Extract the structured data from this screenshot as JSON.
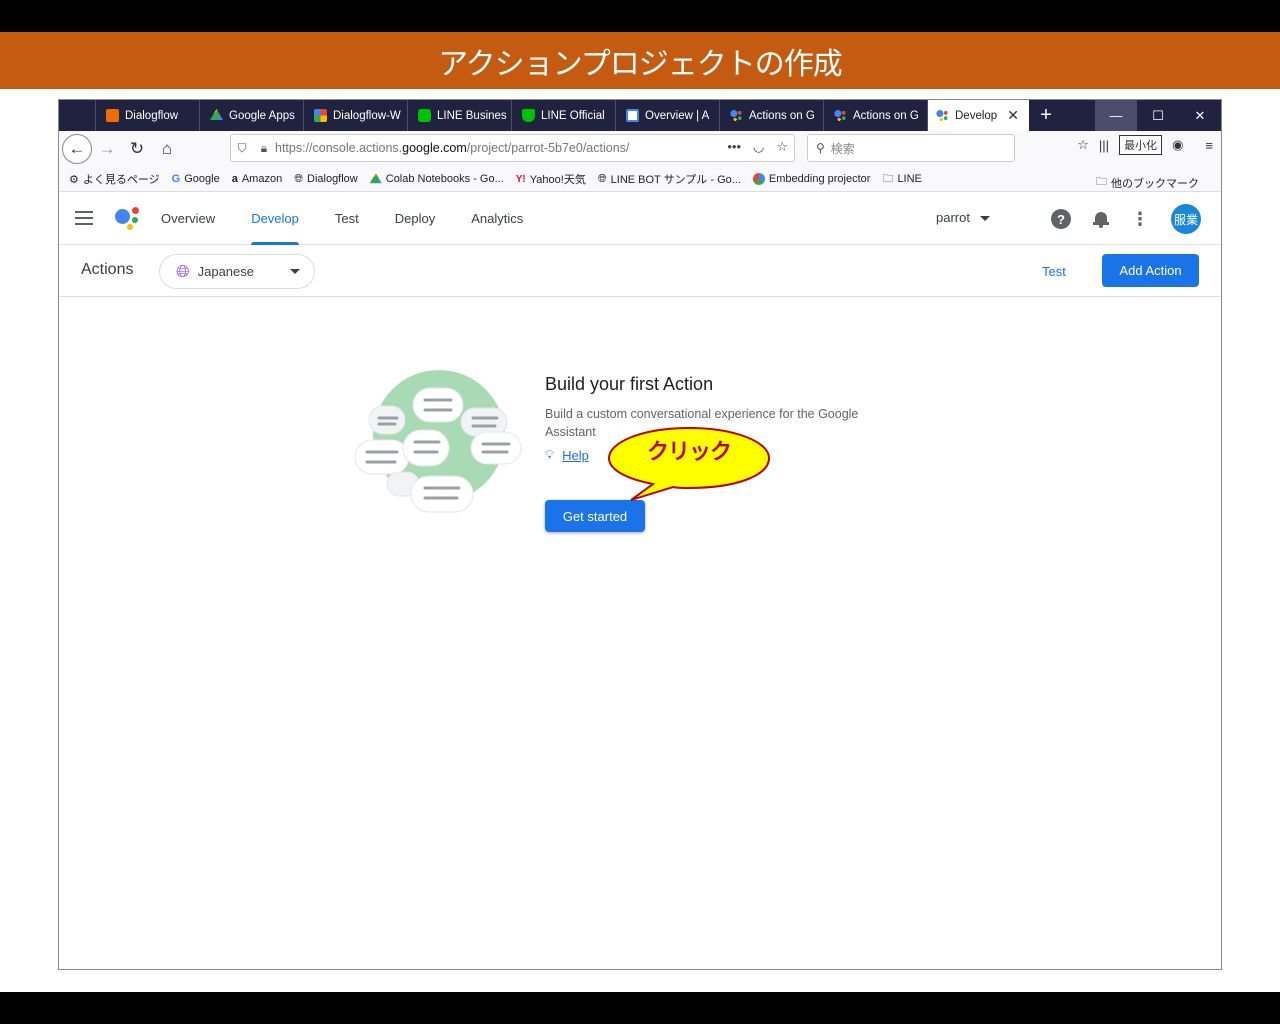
{
  "slide": {
    "title": "アクションプロジェクトの作成"
  },
  "browser": {
    "tabs": [
      {
        "label": "Dialogflow",
        "icon": "dialogflow-icon",
        "color": "#ef6c00"
      },
      {
        "label": "Google Apps",
        "icon": "drive-icon",
        "color": "#34a853"
      },
      {
        "label": "Dialogflow-W",
        "icon": "pinwheel-icon",
        "color": "#fbbc04"
      },
      {
        "label": "LINE Busines",
        "icon": "line-icon",
        "color": "#00c300"
      },
      {
        "label": "LINE Official",
        "icon": "line-official-icon",
        "color": "#00c300"
      },
      {
        "label": "Overview | A",
        "icon": "overview-icon",
        "color": "#ffffff"
      },
      {
        "label": "Actions on G",
        "icon": "assistant-icon",
        "color": "#4285f4"
      },
      {
        "label": "Actions on G",
        "icon": "assistant-icon",
        "color": "#4285f4"
      }
    ],
    "active_tab": {
      "label": "Develop",
      "icon": "assistant-icon"
    },
    "window_buttons": {
      "minimize": "—",
      "maximize": "☐",
      "close": "✕"
    },
    "new_tab": "+",
    "url": {
      "prefix": "https://console.actions.",
      "domain": "google.com",
      "suffix": "/project/parrot-5b7e0/actions/"
    },
    "search_placeholder": "検索",
    "minimize_tooltip": "最小化",
    "bookmarks": [
      {
        "label": "よく見るページ",
        "icon": "gear-icon"
      },
      {
        "label": "Google",
        "icon": "google-icon"
      },
      {
        "label": "Amazon",
        "icon": "amazon-icon"
      },
      {
        "label": "Dialogflow",
        "icon": "globe-icon"
      },
      {
        "label": "Colab Notebooks - Go...",
        "icon": "drive-icon"
      },
      {
        "label": "Yahoo!天気",
        "icon": "yahoo-icon"
      },
      {
        "label": "LINE BOT サンプル - Go...",
        "icon": "globe-icon"
      },
      {
        "label": "Embedding projector",
        "icon": "projector-icon"
      },
      {
        "label": "LINE",
        "icon": "folder-icon"
      }
    ],
    "other_bookmarks": "他のブックマーク"
  },
  "app": {
    "nav_tabs": [
      "Overview",
      "Develop",
      "Test",
      "Deploy",
      "Analytics"
    ],
    "active_nav": "Develop",
    "project": "parrot",
    "avatar_text": "服業",
    "colors": {
      "accent": "#1a73e8"
    }
  },
  "actions_bar": {
    "title": "Actions",
    "language": "Japanese",
    "test_label": "Test",
    "add_action_label": "Add Action"
  },
  "empty_state": {
    "title": "Build your first Action",
    "description": "Build a custom conversational experience for the Google Assistant",
    "help_label": "Help",
    "cta_label": "Get started"
  },
  "callout": {
    "text": "クリック"
  }
}
